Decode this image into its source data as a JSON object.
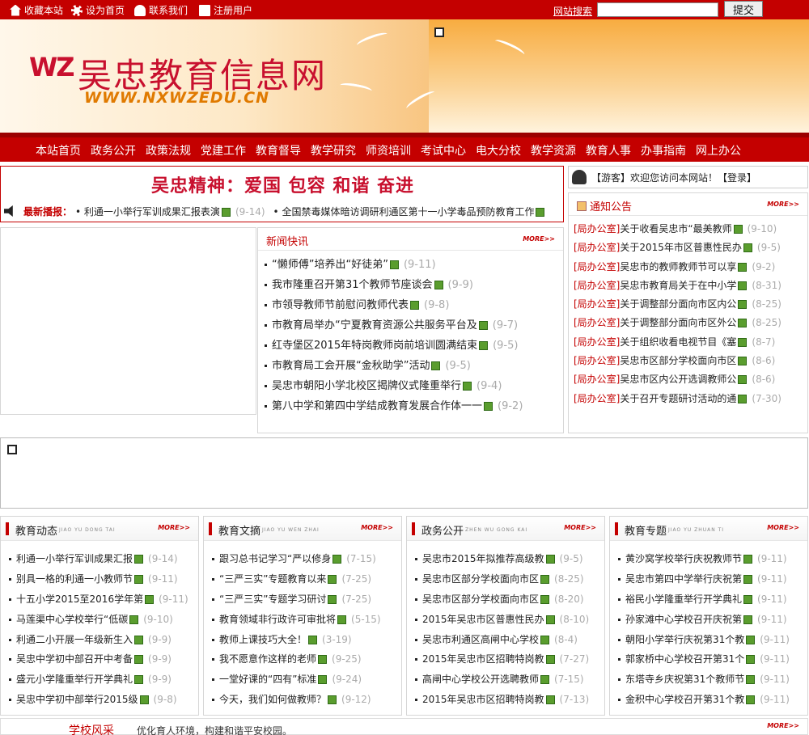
{
  "topbar": {
    "links": [
      {
        "label": "收藏本站",
        "icon": "home-icon"
      },
      {
        "label": "设为首页",
        "icon": "gear-icon"
      },
      {
        "label": "联系我们",
        "icon": "people-icon"
      },
      {
        "label": "注册用户",
        "icon": "register-icon"
      }
    ],
    "search_label": "网站搜索",
    "search_value": "",
    "search_button": "提交"
  },
  "header": {
    "logo_mark": "WZ",
    "logo_title": "吴忠教育信息网",
    "logo_url": "WWW.NXWZEDU.CN"
  },
  "nav": [
    "本站首页",
    "政务公开",
    "政策法规",
    "党建工作",
    "教育督导",
    "教学研究",
    "师资培训",
    "考试中心",
    "电大分校",
    "教学资源",
    "教育人事",
    "办事指南",
    "网上办公"
  ],
  "slogan": "吴忠精神：爱国 包容 和谐 奋进",
  "ticker": {
    "label": "最新播报：",
    "items": [
      {
        "text": "利通一小举行军训成果汇报表演",
        "date": "(9-14)"
      },
      {
        "text": "全国禁毒媒体暗访调研利通区第十一小学毒品预防教育工作",
        "date": ""
      }
    ]
  },
  "visitor": {
    "text": "【游客】欢迎您访问本网站！【登录】"
  },
  "notice": {
    "title": "通知公告",
    "more": "MORE>>",
    "items": [
      {
        "cat": "[局办公室]",
        "text": "关于收看吴忠市“最美教师",
        "date": "(9-10)"
      },
      {
        "cat": "[局办公室]",
        "text": "关于2015年市区普惠性民办",
        "date": "(9-5)"
      },
      {
        "cat": "[局办公室]",
        "text": "吴忠市的教师教师节可以享",
        "date": "(9-2)"
      },
      {
        "cat": "[局办公室]",
        "text": "吴忠市教育局关于在中小学",
        "date": "(8-31)"
      },
      {
        "cat": "[局办公室]",
        "text": "关于调整部分面向市区内公",
        "date": "(8-25)"
      },
      {
        "cat": "[局办公室]",
        "text": "关于调整部分面向市区外公",
        "date": "(8-25)"
      },
      {
        "cat": "[局办公室]",
        "text": "关于组织收看电视节目《塞",
        "date": "(8-7)"
      },
      {
        "cat": "[局办公室]",
        "text": "吴忠市区部分学校面向市区",
        "date": "(8-6)"
      },
      {
        "cat": "[局办公室]",
        "text": "吴忠市区内公开选调教师公",
        "date": "(8-6)"
      },
      {
        "cat": "[局办公室]",
        "text": "关于召开专题研讨活动的通",
        "date": "(7-30)"
      }
    ]
  },
  "news": {
    "title": "新闻快讯",
    "more": "MORE>>",
    "items": [
      {
        "text": "“懒师傅”培养出“好徒弟”",
        "date": "(9-11)"
      },
      {
        "text": "我市隆重召开第31个教师节座谈会",
        "date": "(9-9)"
      },
      {
        "text": "市领导教师节前慰问教师代表",
        "date": "(9-8)"
      },
      {
        "text": "市教育局举办“宁夏教育资源公共服务平台及",
        "date": "(9-7)"
      },
      {
        "text": "红寺堡区2015年特岗教师岗前培训圆满结束",
        "date": "(9-5)"
      },
      {
        "text": "市教育局工会开展“金秋助学”活动",
        "date": "(9-5)"
      },
      {
        "text": "吴忠市朝阳小学北校区揭牌仪式隆重举行",
        "date": "(9-4)"
      },
      {
        "text": "第八中学和第四中学结成教育发展合作体一一",
        "date": "(9-2)"
      }
    ]
  },
  "bottom": [
    {
      "title": "教育动态",
      "pinyin": "JIAO YU DONG TAI",
      "more": "MORE>>",
      "items": [
        {
          "text": "利通一小举行军训成果汇报",
          "date": "(9-14)"
        },
        {
          "text": "别具一格的利通一小教师节",
          "date": "(9-11)"
        },
        {
          "text": "十五小学2015至2016学年第",
          "date": "(9-11)"
        },
        {
          "text": "马莲渠中心学校举行“低碳",
          "date": "(9-10)"
        },
        {
          "text": "利通二小开展一年级新生入",
          "date": "(9-9)"
        },
        {
          "text": "吴忠中学初中部召开中考备",
          "date": "(9-9)"
        },
        {
          "text": "盛元小学隆重举行开学典礼",
          "date": "(9-9)"
        },
        {
          "text": "吴忠中学初中部举行2015级",
          "date": "(9-8)"
        }
      ]
    },
    {
      "title": "教育文摘",
      "pinyin": "JIAO YU WEN ZHAI",
      "more": "MORE>>",
      "items": [
        {
          "text": "跟习总书记学习“严以修身",
          "date": "(7-15)"
        },
        {
          "text": "“三严三实”专题教育以来",
          "date": "(7-25)"
        },
        {
          "text": "“三严三实”专题学习研讨",
          "date": "(7-25)"
        },
        {
          "text": "教育领域非行政许可审批将",
          "date": "(5-15)"
        },
        {
          "text": "教师上课技巧大全！",
          "date": "(3-19)"
        },
        {
          "text": "我不愿意作这样的老师",
          "date": "(9-25)"
        },
        {
          "text": "一堂好课的“四有”标准",
          "date": "(9-24)"
        },
        {
          "text": "今天，我们如何做教师？",
          "date": "(9-12)"
        }
      ]
    },
    {
      "title": "政务公开",
      "pinyin": "ZHEN WU GONG KAI",
      "more": "MORE>>",
      "items": [
        {
          "text": "吴忠市2015年拟推荐高级教",
          "date": "(9-5)"
        },
        {
          "text": "吴忠市区部分学校面向市区",
          "date": "(8-25)"
        },
        {
          "text": "吴忠市区部分学校面向市区",
          "date": "(8-20)"
        },
        {
          "text": "2015年吴忠市区普惠性民办",
          "date": "(8-10)"
        },
        {
          "text": "吴忠市利通区高闸中心学校",
          "date": "(8-4)"
        },
        {
          "text": "2015年吴忠市区招聘特岗教",
          "date": "(7-27)"
        },
        {
          "text": "高闸中心学校公开选聘教师",
          "date": "(7-15)"
        },
        {
          "text": "2015年吴忠市区招聘特岗教",
          "date": "(7-13)"
        }
      ]
    },
    {
      "title": "教育专题",
      "pinyin": "JIAO YU ZHUAN TI",
      "more": "MORE>>",
      "items": [
        {
          "text": "黄沙窝学校举行庆祝教师节",
          "date": "(9-11)"
        },
        {
          "text": "吴忠市第四中学举行庆祝第",
          "date": "(9-11)"
        },
        {
          "text": "裕民小学隆重举行开学典礼",
          "date": "(9-11)"
        },
        {
          "text": "孙家滩中心学校召开庆祝第",
          "date": "(9-11)"
        },
        {
          "text": "朝阳小学举行庆祝第31个教",
          "date": "(9-11)"
        },
        {
          "text": "郭家桥中心学校召开第31个",
          "date": "(9-11)"
        },
        {
          "text": "东塔寺乡庆祝第31个教师节",
          "date": "(9-11)"
        },
        {
          "text": "金积中心学校召开第31个教",
          "date": "(9-11)"
        }
      ]
    }
  ],
  "school": {
    "title": "学校风采",
    "desc": "优化育人环境，构建和谐平安校园。",
    "more": "MORE>>"
  },
  "colors": {
    "brand": "#c40000",
    "date": "#aaaaaa"
  }
}
